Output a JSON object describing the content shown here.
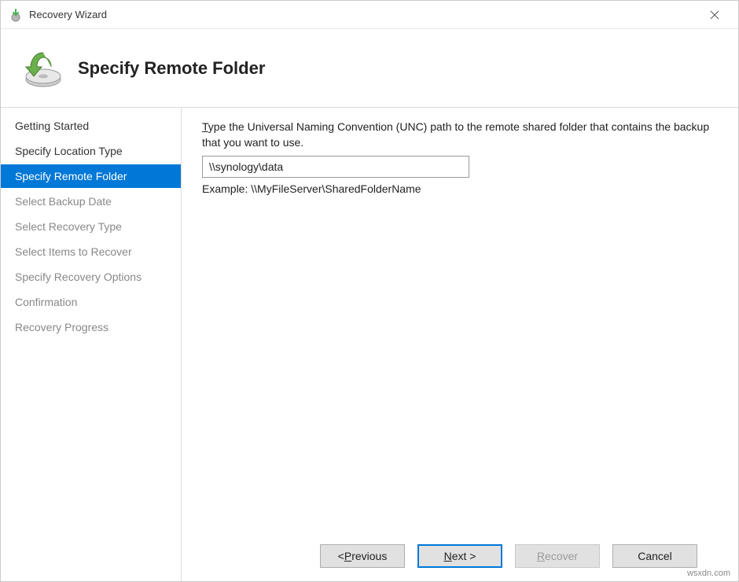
{
  "titlebar": {
    "title": "Recovery Wizard"
  },
  "header": {
    "page_title": "Specify Remote Folder"
  },
  "sidebar": {
    "steps": [
      {
        "label": "Getting Started",
        "state": "normal"
      },
      {
        "label": "Specify Location Type",
        "state": "normal"
      },
      {
        "label": "Specify Remote Folder",
        "state": "active"
      },
      {
        "label": "Select Backup Date",
        "state": "disabled"
      },
      {
        "label": "Select Recovery Type",
        "state": "disabled"
      },
      {
        "label": "Select Items to Recover",
        "state": "disabled"
      },
      {
        "label": "Specify Recovery Options",
        "state": "disabled"
      },
      {
        "label": "Confirmation",
        "state": "disabled"
      },
      {
        "label": "Recovery Progress",
        "state": "disabled"
      }
    ]
  },
  "content": {
    "instruction_prefix": "T",
    "instruction_rest": "ype the Universal Naming Convention (UNC) path to the remote shared folder that contains the backup that you want to use.",
    "path_value": "\\\\synology\\data",
    "example": "Example: \\\\MyFileServer\\SharedFolderName"
  },
  "footer": {
    "previous_prefix": "< ",
    "previous_hot": "P",
    "previous_rest": "revious",
    "next_hot": "N",
    "next_rest": "ext >",
    "recover_hot": "R",
    "recover_rest": "ecover",
    "cancel": "Cancel"
  },
  "watermark": "wsxdn.com"
}
